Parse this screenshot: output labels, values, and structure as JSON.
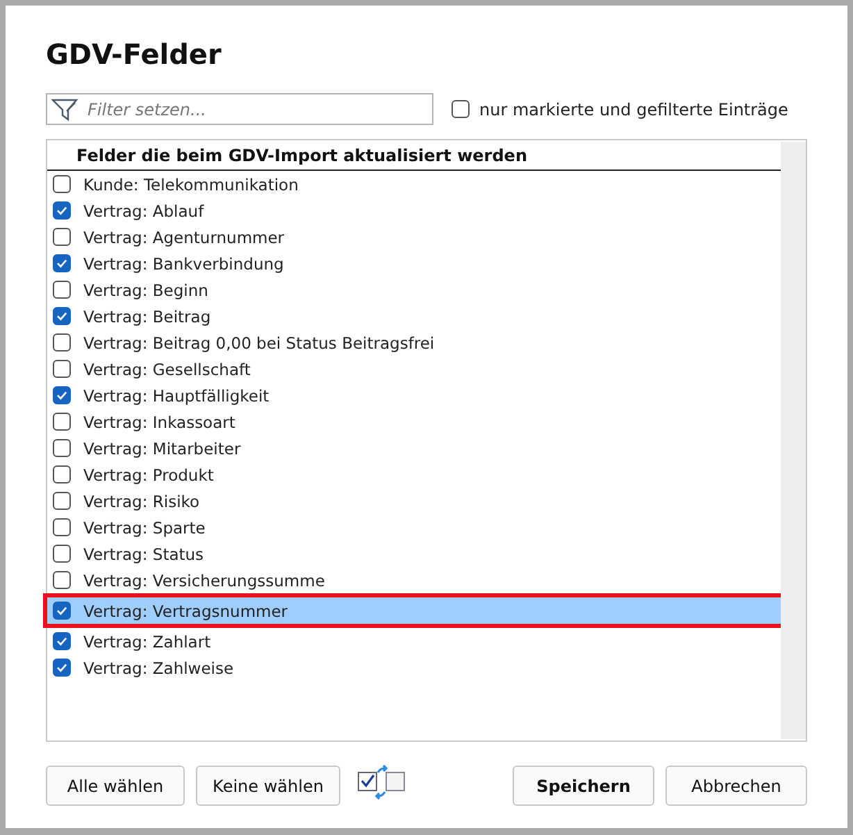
{
  "window": {
    "title": "GDV-Felder"
  },
  "filter": {
    "placeholder": "Filter setzen..."
  },
  "only_marked": {
    "label": "nur markierte und gefilterte Einträge",
    "checked": false
  },
  "list": {
    "header": "Felder die beim GDV-Import aktualisiert werden",
    "items": [
      {
        "label": "Kunde: Telekommunikation",
        "checked": false,
        "selected": false
      },
      {
        "label": "Vertrag: Ablauf",
        "checked": true,
        "selected": false
      },
      {
        "label": "Vertrag: Agenturnummer",
        "checked": false,
        "selected": false
      },
      {
        "label": "Vertrag: Bankverbindung",
        "checked": true,
        "selected": false
      },
      {
        "label": "Vertrag: Beginn",
        "checked": false,
        "selected": false
      },
      {
        "label": "Vertrag: Beitrag",
        "checked": true,
        "selected": false
      },
      {
        "label": "Vertrag: Beitrag 0,00 bei Status Beitragsfrei",
        "checked": false,
        "selected": false
      },
      {
        "label": "Vertrag: Gesellschaft",
        "checked": false,
        "selected": false
      },
      {
        "label": "Vertrag: Hauptfälligkeit",
        "checked": true,
        "selected": false
      },
      {
        "label": "Vertrag: Inkassoart",
        "checked": false,
        "selected": false
      },
      {
        "label": "Vertrag: Mitarbeiter",
        "checked": false,
        "selected": false
      },
      {
        "label": "Vertrag: Produkt",
        "checked": false,
        "selected": false
      },
      {
        "label": "Vertrag: Risiko",
        "checked": false,
        "selected": false
      },
      {
        "label": "Vertrag: Sparte",
        "checked": false,
        "selected": false
      },
      {
        "label": "Vertrag: Status",
        "checked": false,
        "selected": false
      },
      {
        "label": "Vertrag: Versicherungssumme",
        "checked": false,
        "selected": false
      },
      {
        "label": "Vertrag: Vertragsnummer",
        "checked": true,
        "selected": true
      },
      {
        "label": "Vertrag: Zahlart",
        "checked": true,
        "selected": false
      },
      {
        "label": "Vertrag: Zahlweise",
        "checked": true,
        "selected": false
      }
    ]
  },
  "buttons_left": [
    {
      "label": "Alle wählen"
    },
    {
      "label": "Keine wählen"
    }
  ],
  "buttons_right": [
    {
      "label": "Speichern",
      "kind": "default"
    },
    {
      "label": "Abbrechen",
      "kind": "normal"
    }
  ]
}
